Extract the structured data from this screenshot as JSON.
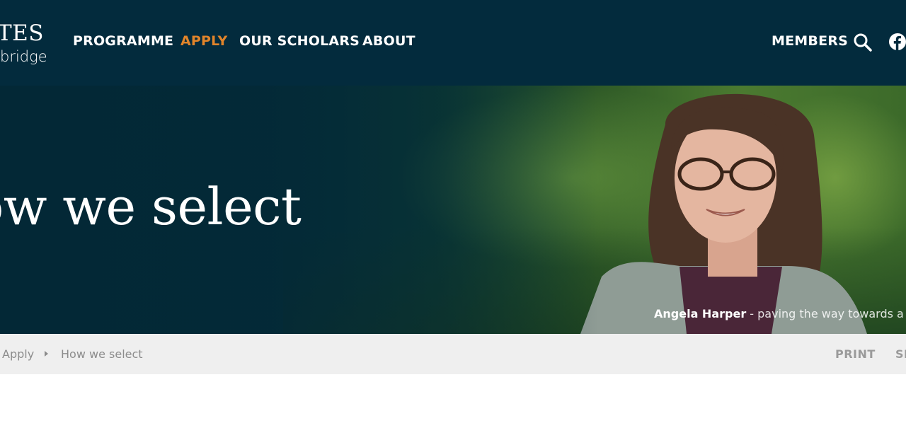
{
  "logo": {
    "line1": "TES",
    "line2": "bridge"
  },
  "nav": {
    "items": [
      {
        "label": "PROGRAMME"
      },
      {
        "label": "APPLY"
      },
      {
        "label": "OUR SCHOLARS"
      },
      {
        "label": "ABOUT"
      }
    ],
    "members_label": "MEMBERS",
    "accent_color": "#e1842a"
  },
  "hero": {
    "title": "ow we select",
    "caption_name": "Angela Harper",
    "caption_text": " - paving the way towards a gr"
  },
  "breadcrumb": {
    "items": [
      "Apply",
      "How we select"
    ]
  },
  "utilities": {
    "print_label": "PRINT",
    "share_label": "SH"
  },
  "colors": {
    "header_bg": "#032b3d",
    "breadcrumb_bg": "#efefef"
  }
}
